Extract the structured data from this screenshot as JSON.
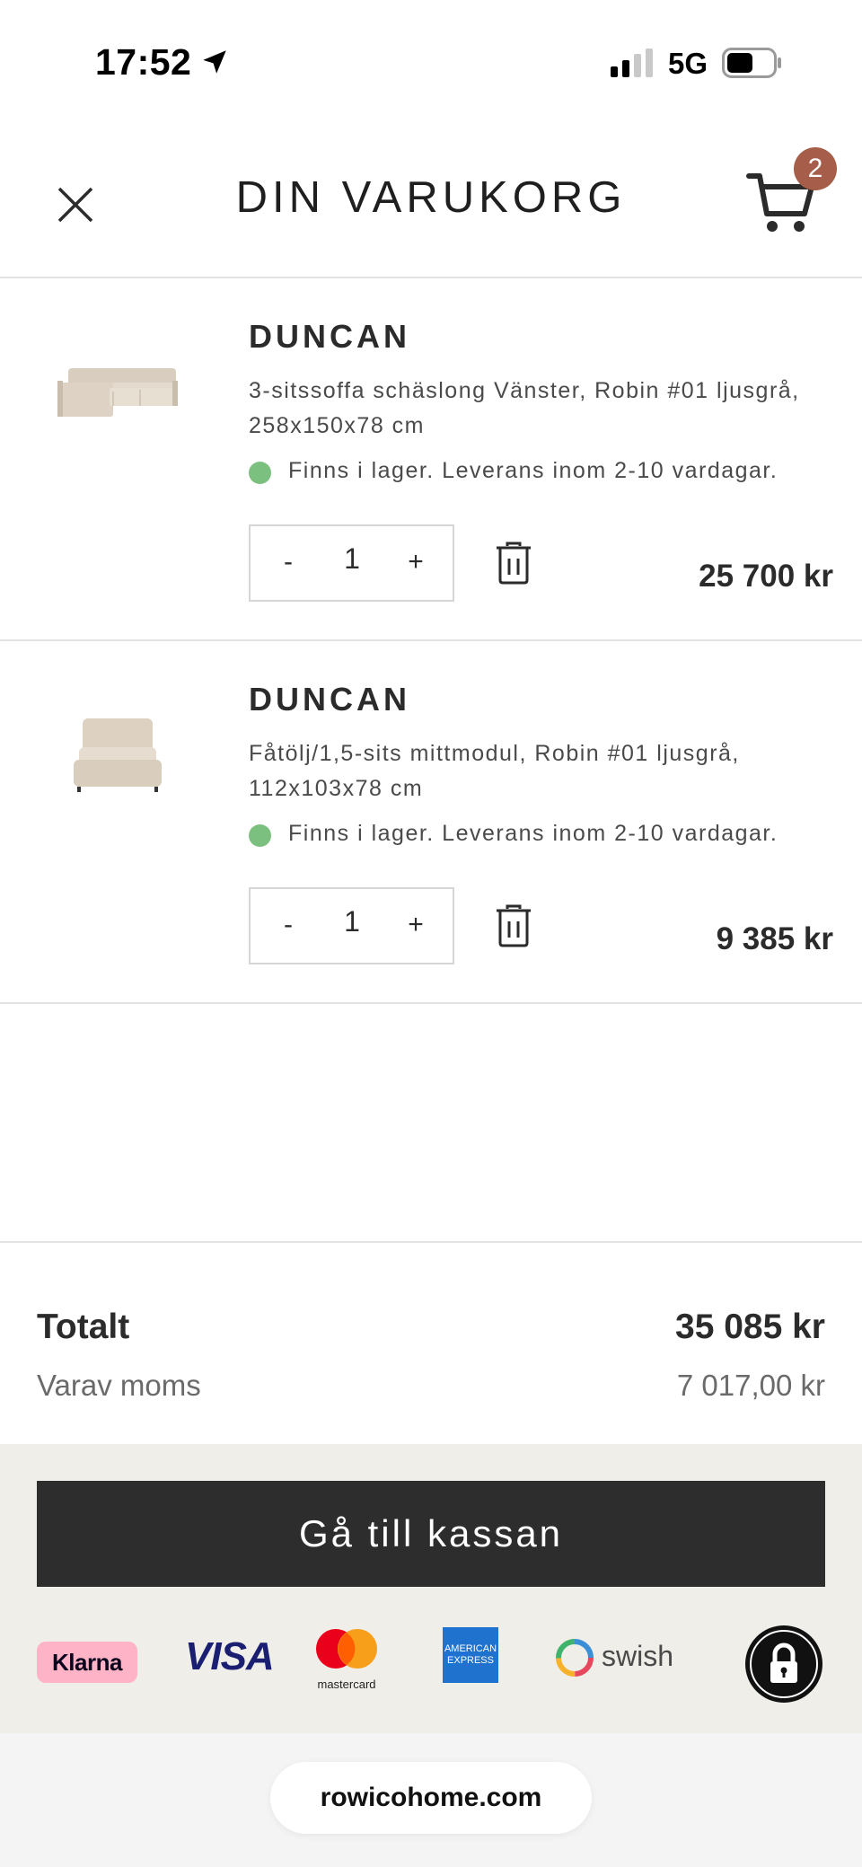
{
  "status_bar": {
    "time": "17:52",
    "network": "5G"
  },
  "header": {
    "title": "DIN VARUKORG",
    "cart_count": "2"
  },
  "items": [
    {
      "name": "DUNCAN",
      "description": "3-sitssoffa schäslong Vänster, Robin #01 ljusgrå, 258x150x78 cm",
      "stock": "Finns i lager. Leverans inom 2-10 vardagar.",
      "qty_minus": "-",
      "quantity": "1",
      "qty_plus": "+",
      "price": "25 700 kr"
    },
    {
      "name": "DUNCAN",
      "description": "Fåtölj/1,5-sits mittmodul, Robin #01 ljusgrå, 112x103x78 cm",
      "stock": "Finns i lager. Leverans inom 2-10 vardagar.",
      "qty_minus": "-",
      "quantity": "1",
      "qty_plus": "+",
      "price": "9 385 kr"
    }
  ],
  "totals": {
    "total_label": "Totalt",
    "total_value": "35 085 kr",
    "vat_label": "Varav moms",
    "vat_value": "7 017,00 kr"
  },
  "checkout": {
    "button_label": "Gå till kassan"
  },
  "payment_methods": {
    "klarna": "Klarna",
    "visa": "VISA",
    "mastercard": "mastercard",
    "amex": "AMERICAN EXPRESS",
    "swish": "swish",
    "trygg": "TRYGG E-HANDEL"
  },
  "browser": {
    "url": "rowicohome.com"
  },
  "colors": {
    "accent_badge": "#a65d49",
    "stock_ok": "#7cc07f",
    "checkout_bg": "#2d2d2d",
    "footer_bg": "#efeee9"
  },
  "icons": [
    "location-arrow-icon",
    "signal-icon",
    "battery-icon",
    "close-icon",
    "cart-icon",
    "trash-icon",
    "trygg-lock-icon"
  ]
}
